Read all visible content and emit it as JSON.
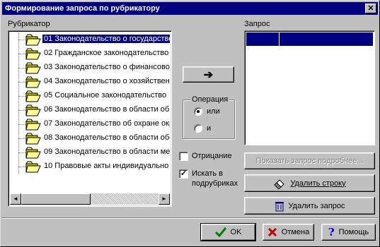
{
  "window": {
    "title": "Формирование запроса по рубрикатору",
    "close_glyph": "✕"
  },
  "rubricator": {
    "label": "Рубрикатор",
    "items": [
      {
        "label": "01 Законодательство о государстве",
        "selected": true
      },
      {
        "label": "02 Гражданское законодательство"
      },
      {
        "label": "03 Законодательство о финансово-"
      },
      {
        "label": "04 Законодательство о хозяйствен"
      },
      {
        "label": "05 Социальное законодательство"
      },
      {
        "label": "06 Законодательство в области об"
      },
      {
        "label": "07 Законодательство об охране окр"
      },
      {
        "label": "08 Законодательство в области обо"
      },
      {
        "label": "09 Законодательство в области ме"
      },
      {
        "label": "10 Правовые акты индивидуально"
      }
    ],
    "scroll_left_glyph": "◄",
    "scroll_right_glyph": "►"
  },
  "add_button": {
    "glyph": "➔"
  },
  "operation": {
    "title": "Операция",
    "options": [
      {
        "label": "или",
        "checked": true
      },
      {
        "label": "и",
        "checked": false
      }
    ]
  },
  "negation": {
    "label": "Отрицание",
    "checked": false
  },
  "search_sub": {
    "label_line1": "Искать в",
    "label_line2": "подрубриках",
    "checked": true,
    "check_glyph": "✓"
  },
  "query": {
    "label": "Запрос"
  },
  "buttons": {
    "show_query": "Показать запрос подробнее...",
    "delete_row": "Удалить строку",
    "delete_query": "Удалить запрос",
    "ok": "OK",
    "cancel": "Отмена",
    "help": "Помощь"
  },
  "icons": {
    "arrow": "arrow-right-icon",
    "delete_row": "eraser-icon",
    "delete_query": "trash-icon",
    "ok": "checkmark-icon",
    "cancel": "cross-icon",
    "help": "question-icon"
  },
  "colors": {
    "selection": "#000080",
    "face": "#c0c0c0",
    "folder": "#ffff99",
    "ok_check": "#008000",
    "cancel_cross": "#c00000",
    "help_q": "#0000c0"
  }
}
